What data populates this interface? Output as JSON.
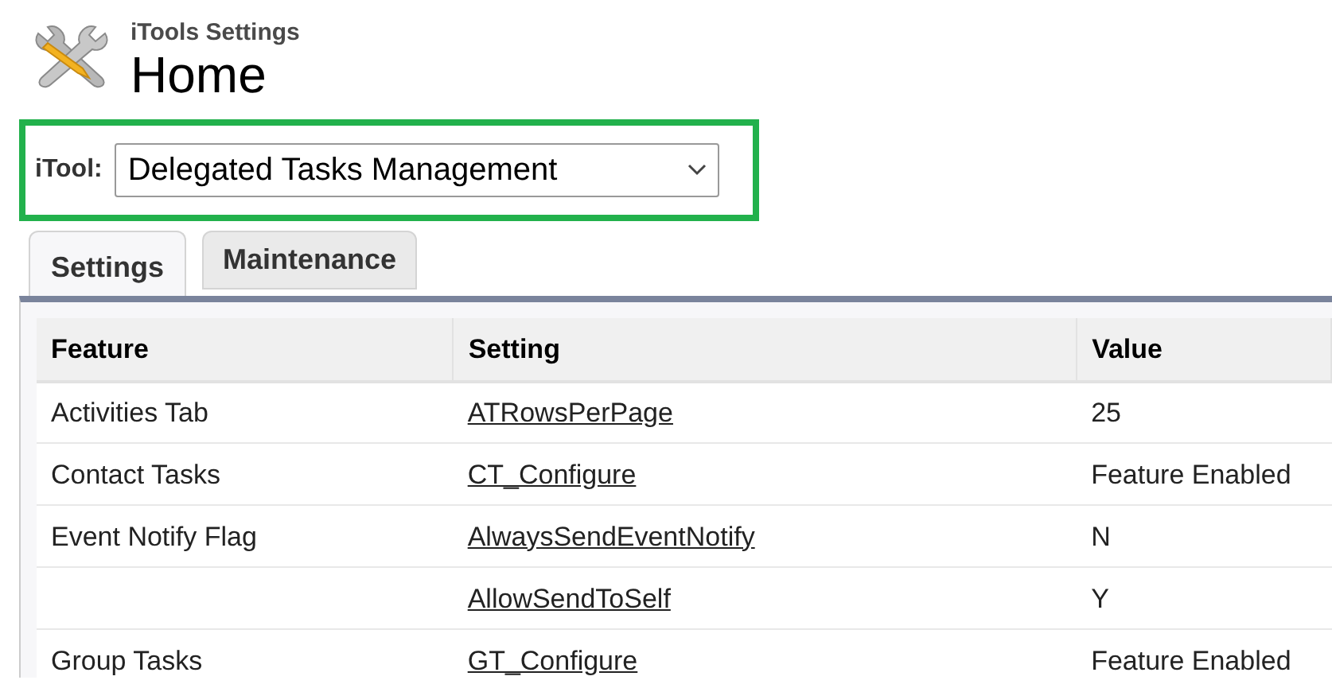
{
  "header": {
    "subtitle": "iTools Settings",
    "title": "Home"
  },
  "itool_select": {
    "label": "iTool:",
    "value": "Delegated Tasks Management"
  },
  "tabs": [
    {
      "label": "Settings",
      "selected": true
    },
    {
      "label": "Maintenance",
      "selected": false
    }
  ],
  "table": {
    "columns": [
      "Feature",
      "Setting",
      "Value"
    ],
    "rows": [
      {
        "feature": "Activities Tab",
        "setting": "ATRowsPerPage",
        "value": "25"
      },
      {
        "feature": "Contact Tasks",
        "setting": "CT_Configure",
        "value": "Feature Enabled"
      },
      {
        "feature": "Event Notify Flag",
        "setting": "AlwaysSendEventNotify",
        "value": "N"
      },
      {
        "feature": "",
        "setting": "AllowSendToSelf",
        "value": "Y"
      },
      {
        "feature": "Group Tasks",
        "setting": "GT_Configure",
        "value": "Feature Enabled"
      }
    ]
  }
}
